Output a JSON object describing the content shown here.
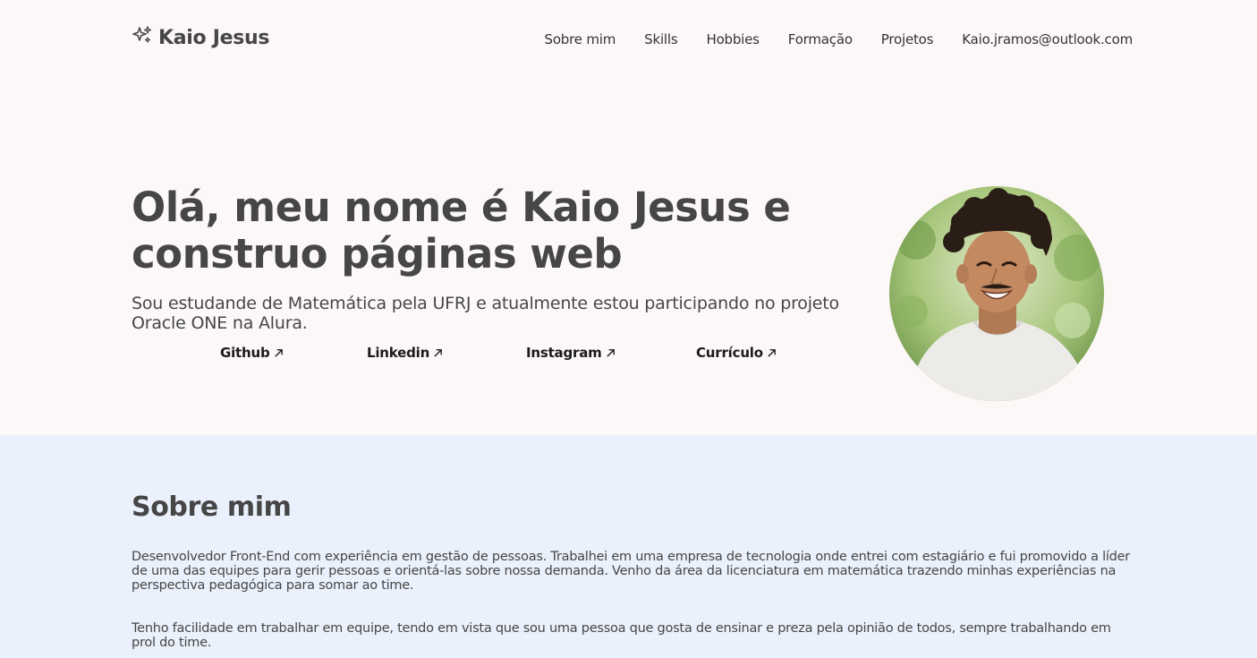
{
  "header": {
    "logo_icon": "sparkles-icon",
    "logo_text": "Kaio Jesus",
    "nav": [
      {
        "label": "Sobre mim"
      },
      {
        "label": "Skills"
      },
      {
        "label": "Hobbies"
      },
      {
        "label": "Formação"
      },
      {
        "label": "Projetos"
      },
      {
        "label": "Kaio.jramos@outlook.com"
      }
    ]
  },
  "hero": {
    "title_line1": "Olá, meu nome é Kaio Jesus e",
    "title_line2": "construo páginas web",
    "subtitle": "Sou estudande de Matemática pela UFRJ e atualmente estou participando no projeto Oracle ONE na Alura.",
    "links": [
      {
        "label": "Github",
        "icon": "arrow-up-right-icon"
      },
      {
        "label": "Linkedin",
        "icon": "arrow-up-right-icon"
      },
      {
        "label": "Instagram",
        "icon": "arrow-up-right-icon"
      },
      {
        "label": "Currículo",
        "icon": "arrow-up-right-icon"
      }
    ],
    "photo": "profile-photo"
  },
  "about": {
    "heading": "Sobre mim",
    "p1": "Desenvolvedor Front-End com experiência em gestão de pessoas. Trabalhei em uma empresa de tecnologia onde entrei com estagiário e fui promovido a líder de uma das equipes para gerir pessoas e orientá-las sobre nossa demanda. Venho da área da licenciatura em matemática trazendo minhas experiências na perspectiva pedagógica para somar ao time.",
    "p2": "Tenho facilidade em trabalhar em equipe, tendo em vista que sou uma pessoa que gosta de ensinar e preza pela opinião de todos, sempre trabalhando em prol do time."
  },
  "colors": {
    "hero_bg": "#fdf8f8",
    "about_bg": "#eaf1fc",
    "text": "#464646"
  }
}
